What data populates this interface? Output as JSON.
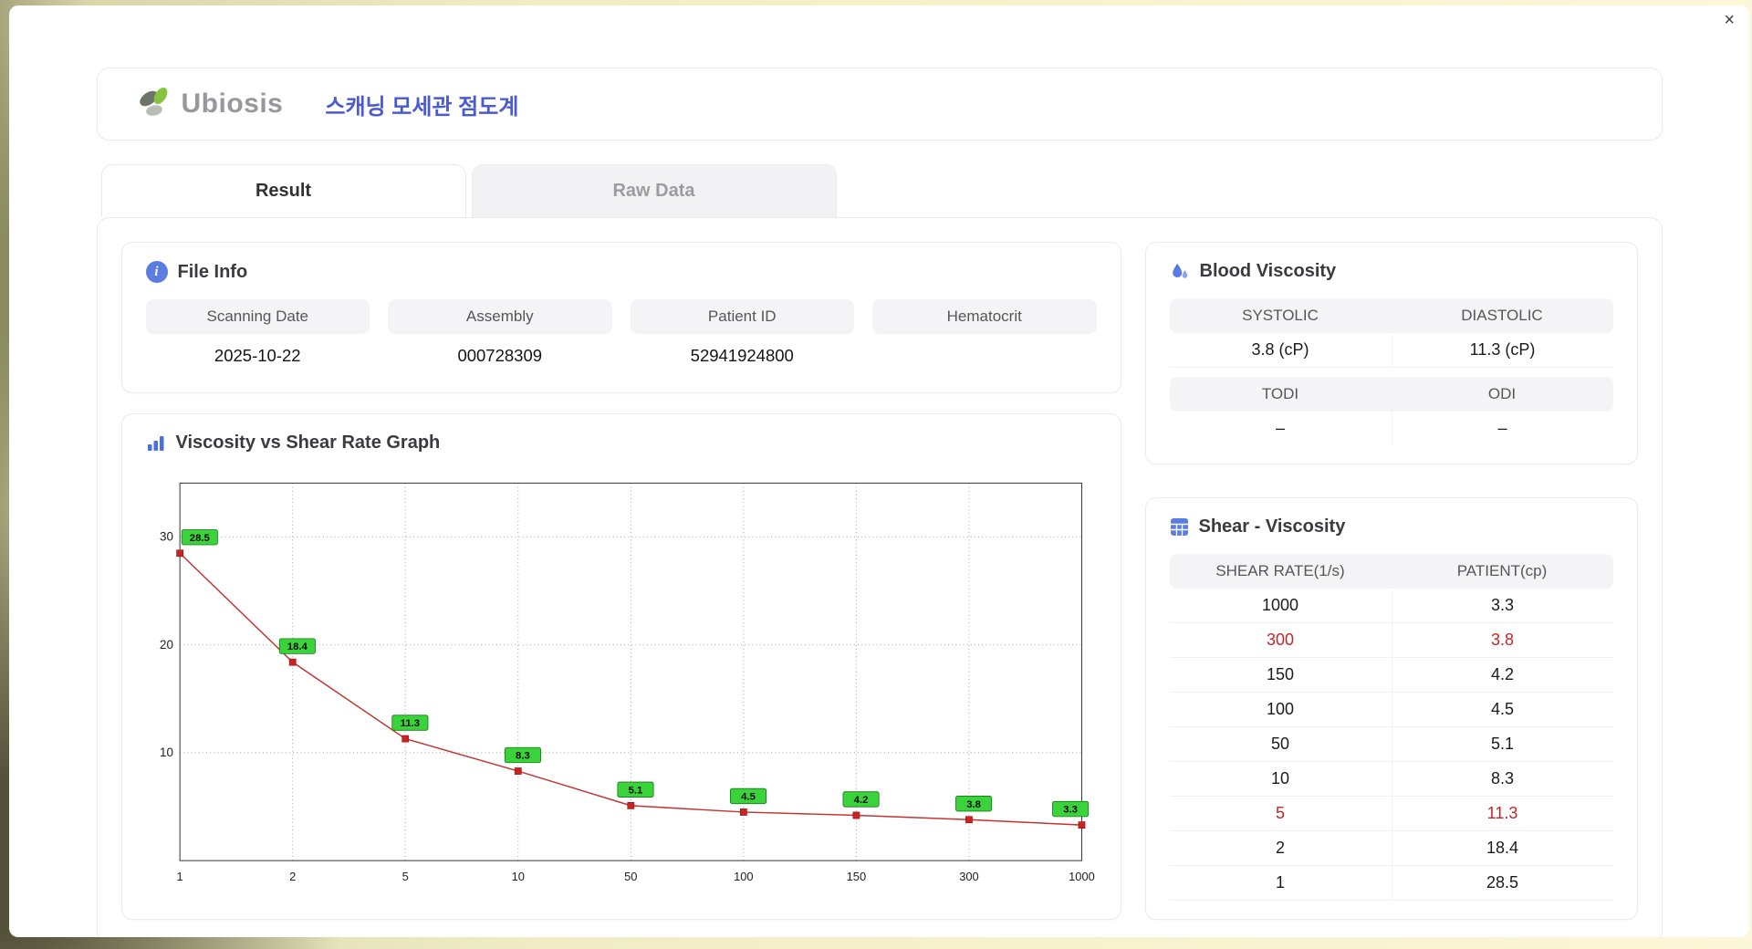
{
  "window": {
    "close_label": "×"
  },
  "brand": {
    "logo_text": "Ubiosis",
    "app_title": "스캐닝 모세관 점도계"
  },
  "tabs": [
    {
      "label": "Result"
    },
    {
      "label": "Raw Data"
    }
  ],
  "file_info": {
    "title": "File Info",
    "fields": [
      {
        "label": "Scanning Date",
        "value": "2025-10-22"
      },
      {
        "label": "Assembly",
        "value": "000728309"
      },
      {
        "label": "Patient ID",
        "value": "52941924800"
      },
      {
        "label": "Hematocrit",
        "value": ""
      }
    ]
  },
  "blood_viscosity": {
    "title": "Blood Viscosity",
    "row1": [
      {
        "label": "SYSTOLIC",
        "value": "3.8 (cP)"
      },
      {
        "label": "DIASTOLIC",
        "value": "11.3 (cP)"
      }
    ],
    "row2": [
      {
        "label": "TODI",
        "value": "–"
      },
      {
        "label": "ODI",
        "value": "–"
      }
    ]
  },
  "graph": {
    "title": "Viscosity vs Shear Rate Graph"
  },
  "chart_data": {
    "type": "line",
    "title": "Viscosity vs Shear Rate Graph",
    "x_scale": "categorical (log-spaced shear rates)",
    "categories": [
      1,
      2,
      5,
      10,
      50,
      100,
      150,
      300,
      1000
    ],
    "values": [
      28.5,
      18.4,
      11.3,
      8.3,
      5.1,
      4.5,
      4.2,
      3.8,
      3.3
    ],
    "point_labels": [
      "28.5",
      "18.4",
      "11.3",
      "8.3",
      "5.1",
      "4.5",
      "4.2",
      "3.8",
      "3.3"
    ],
    "yticks": [
      10,
      20,
      30
    ],
    "ylim": [
      0,
      35
    ],
    "grid": true,
    "line_color": "#c23333",
    "marker_color": "#cc2222",
    "label_bg": "#3bd33b",
    "label_border": "#157a15"
  },
  "shear_table": {
    "title": "Shear - Viscosity",
    "columns": [
      "SHEAR RATE(1/s)",
      "PATIENT(cp)"
    ],
    "rows": [
      {
        "shear": "1000",
        "patient": "3.3",
        "highlight": false
      },
      {
        "shear": "300",
        "patient": "3.8",
        "highlight": true
      },
      {
        "shear": "150",
        "patient": "4.2",
        "highlight": false
      },
      {
        "shear": "100",
        "patient": "4.5",
        "highlight": false
      },
      {
        "shear": "50",
        "patient": "5.1",
        "highlight": false
      },
      {
        "shear": "10",
        "patient": "8.3",
        "highlight": false
      },
      {
        "shear": "5",
        "patient": "11.3",
        "highlight": true
      },
      {
        "shear": "2",
        "patient": "18.4",
        "highlight": false
      },
      {
        "shear": "1",
        "patient": "28.5",
        "highlight": false
      }
    ]
  },
  "colors": {
    "accent_blue": "#4c5ad2",
    "icon_blue": "#5b7ce0",
    "highlight_red": "#c32727"
  }
}
